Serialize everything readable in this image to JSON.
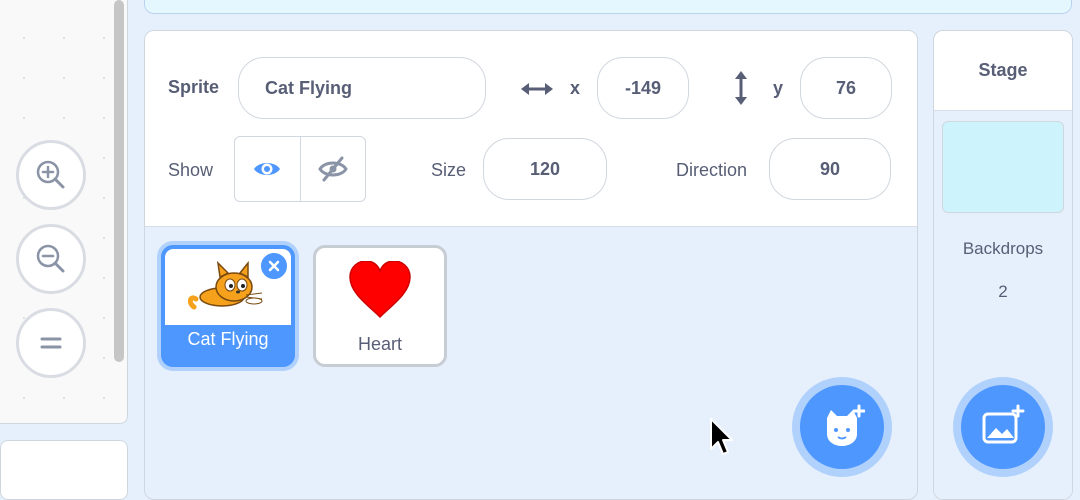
{
  "sprite_info": {
    "sprite_label": "Sprite",
    "sprite_name": "Cat Flying",
    "x_label": "x",
    "x_value": "-149",
    "y_label": "y",
    "y_value": "76",
    "show_label": "Show",
    "size_label": "Size",
    "size_value": "120",
    "direction_label": "Direction",
    "direction_value": "90"
  },
  "sprites": [
    {
      "name": "Cat Flying",
      "selected": true
    },
    {
      "name": "Heart",
      "selected": false
    }
  ],
  "stage": {
    "title": "Stage",
    "backdrops_label": "Backdrops",
    "backdrops_count": "2"
  },
  "colors": {
    "accent": "#4d97ff",
    "stage_backdrop": "#cdf3fc"
  }
}
